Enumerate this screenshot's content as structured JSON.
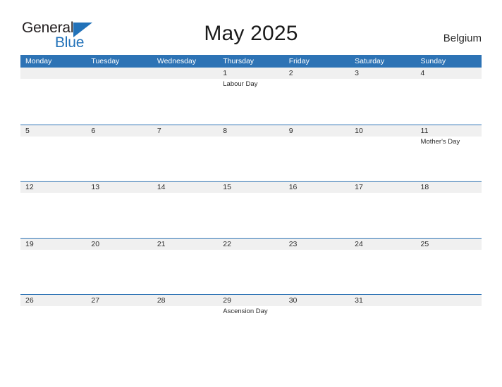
{
  "brand": {
    "name_part1": "General",
    "name_part2": "Blue",
    "triangle_color": "#2272b9"
  },
  "header": {
    "title": "May 2025",
    "region": "Belgium"
  },
  "theme": {
    "header_bar": "#2d73b5",
    "row_band": "#f0f0f0",
    "rule": "#2d73b5",
    "text": "#2b2b2b",
    "header_text": "#ffffff"
  },
  "calendar": {
    "weekdays": [
      "Monday",
      "Tuesday",
      "Wednesday",
      "Thursday",
      "Friday",
      "Saturday",
      "Sunday"
    ],
    "weeks": [
      [
        {
          "day": "",
          "event": ""
        },
        {
          "day": "",
          "event": ""
        },
        {
          "day": "",
          "event": ""
        },
        {
          "day": "1",
          "event": "Labour Day"
        },
        {
          "day": "2",
          "event": ""
        },
        {
          "day": "3",
          "event": ""
        },
        {
          "day": "4",
          "event": ""
        }
      ],
      [
        {
          "day": "5",
          "event": ""
        },
        {
          "day": "6",
          "event": ""
        },
        {
          "day": "7",
          "event": ""
        },
        {
          "day": "8",
          "event": ""
        },
        {
          "day": "9",
          "event": ""
        },
        {
          "day": "10",
          "event": ""
        },
        {
          "day": "11",
          "event": "Mother's Day"
        }
      ],
      [
        {
          "day": "12",
          "event": ""
        },
        {
          "day": "13",
          "event": ""
        },
        {
          "day": "14",
          "event": ""
        },
        {
          "day": "15",
          "event": ""
        },
        {
          "day": "16",
          "event": ""
        },
        {
          "day": "17",
          "event": ""
        },
        {
          "day": "18",
          "event": ""
        }
      ],
      [
        {
          "day": "19",
          "event": ""
        },
        {
          "day": "20",
          "event": ""
        },
        {
          "day": "21",
          "event": ""
        },
        {
          "day": "22",
          "event": ""
        },
        {
          "day": "23",
          "event": ""
        },
        {
          "day": "24",
          "event": ""
        },
        {
          "day": "25",
          "event": ""
        }
      ],
      [
        {
          "day": "26",
          "event": ""
        },
        {
          "day": "27",
          "event": ""
        },
        {
          "day": "28",
          "event": ""
        },
        {
          "day": "29",
          "event": "Ascension Day"
        },
        {
          "day": "30",
          "event": ""
        },
        {
          "day": "31",
          "event": ""
        },
        {
          "day": "",
          "event": ""
        }
      ]
    ]
  }
}
